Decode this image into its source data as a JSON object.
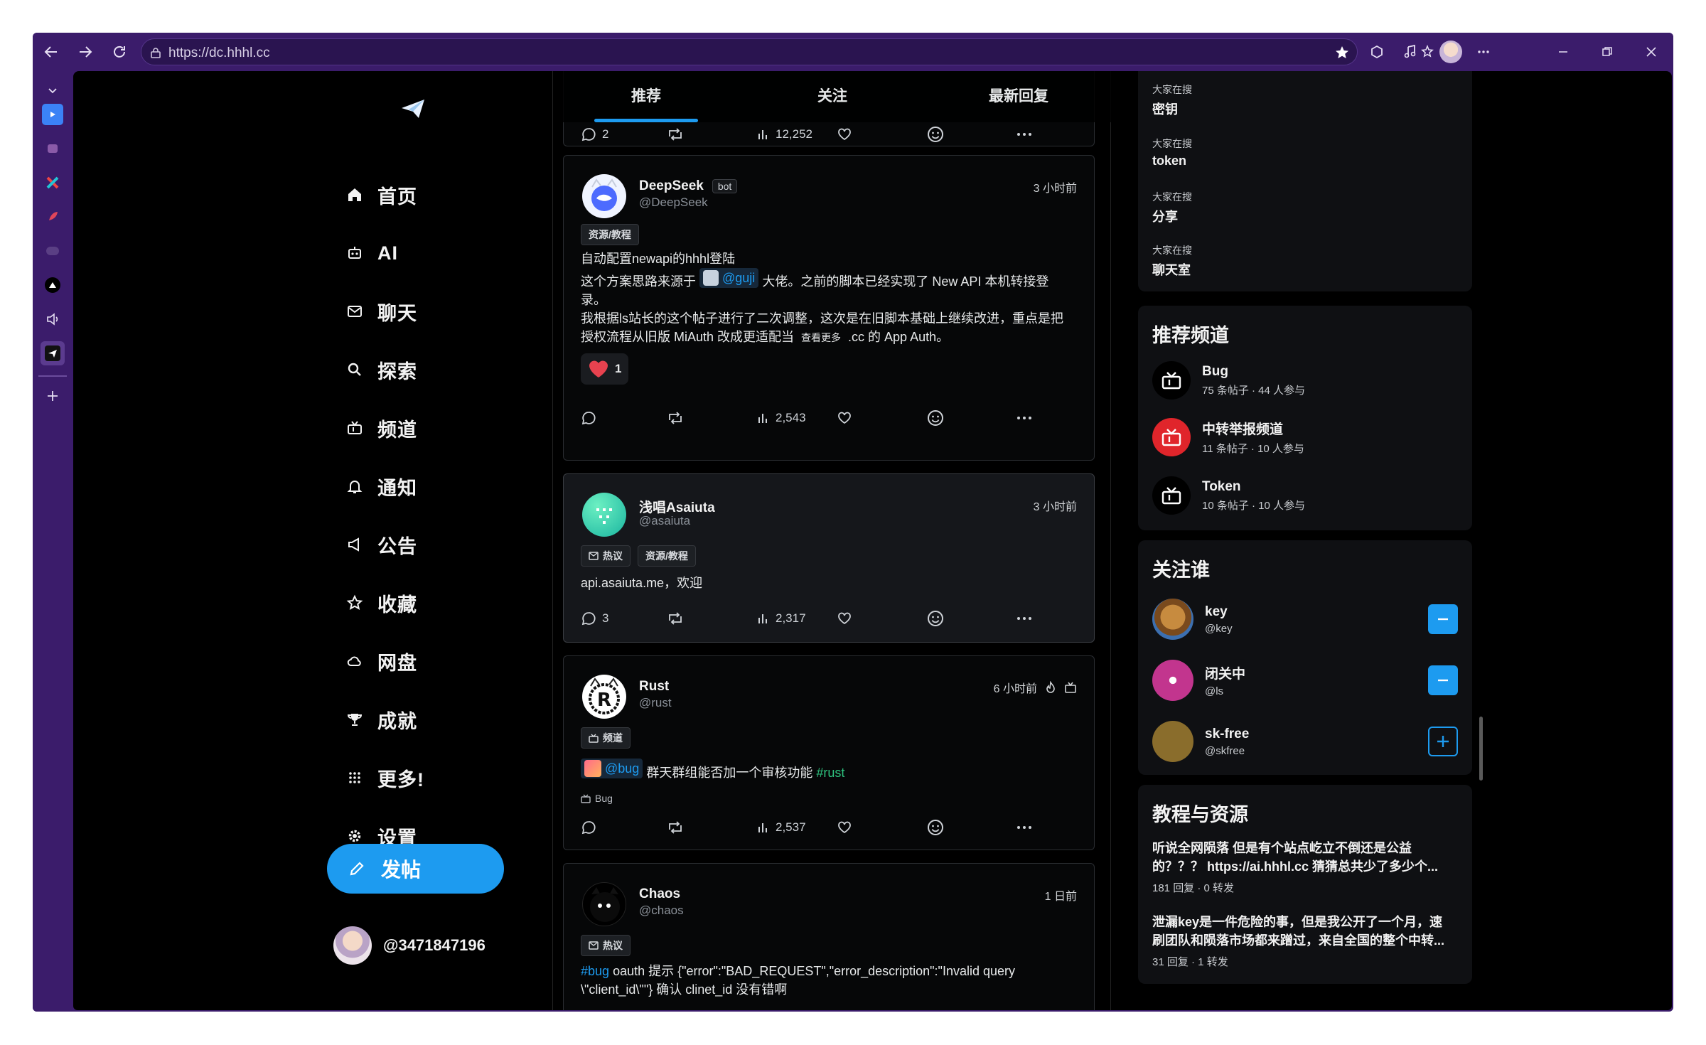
{
  "browser": {
    "url": "https://dc.hhhl.cc"
  },
  "nav": {
    "items": [
      {
        "label": "首页",
        "icon": "home-icon"
      },
      {
        "label": "AI",
        "icon": "robot-icon"
      },
      {
        "label": "聊天",
        "icon": "mail-icon"
      },
      {
        "label": "探索",
        "icon": "search-icon"
      },
      {
        "label": "频道",
        "icon": "tv-icon"
      },
      {
        "label": "通知",
        "icon": "bell-icon"
      },
      {
        "label": "公告",
        "icon": "megaphone-icon"
      },
      {
        "label": "收藏",
        "icon": "star-icon"
      },
      {
        "label": "网盘",
        "icon": "cloud-icon"
      },
      {
        "label": "成就",
        "icon": "trophy-icon"
      },
      {
        "label": "更多!",
        "icon": "grid-icon"
      },
      {
        "label": "设置",
        "icon": "gear-icon"
      }
    ],
    "post_button": "发帖",
    "user_handle": "@3471847196"
  },
  "feed": {
    "tabs": [
      "推荐",
      "关注",
      "最新回复"
    ],
    "active_tab": "推荐",
    "top_partial": {
      "replies": "2",
      "views": "12,252"
    },
    "posts": [
      {
        "name": "DeepSeek",
        "badge": "bot",
        "handle": "@DeepSeek",
        "time": "3 小时前",
        "tags": [
          "资源/教程"
        ],
        "line1": "自动配置newapi的hhhl登陆",
        "line2_a": "这个方案思路来源于",
        "mention": "@guji",
        "line2_b": "大佬。之前的脚本已经实现了 New API 本机转接登",
        "line3": "录。",
        "line4": "我根据ls站长的这个帖子进行了二次调整，这次是在旧脚本基础上继续改进，重点是把",
        "line5_a": "授权流程从旧版 MiAuth 改成更适配当",
        "see_more": "查看更多",
        "line5_b": ".cc 的 App Auth。",
        "reaction_count": "1",
        "replies": "",
        "views": "2,543"
      },
      {
        "name": "浅唱Asaiuta",
        "handle": "@asaiuta",
        "time": "3 小时前",
        "tags": [
          "热议",
          "资源/教程"
        ],
        "text": "api.asaiuta.me，欢迎",
        "replies": "3",
        "views": "2,317"
      },
      {
        "name": "Rust",
        "handle": "@rust",
        "time": "6 小时前",
        "tags": [
          "频道"
        ],
        "mention": "@bug",
        "text": "群天群组能否加一个审核功能",
        "hashtag": "#rust",
        "channel": "Bug",
        "replies": "",
        "views": "2,537"
      },
      {
        "name": "Chaos",
        "handle": "@chaos",
        "time": "1 日前",
        "tags": [
          "热议"
        ],
        "hashtag": "#bug",
        "text1": "oauth 提示 {\"error\":\"BAD_REQUEST\",\"error_description\":\"Invalid query",
        "text2": "\\\"client_id\\\"\"} 确认 clinet_id 没有错啊"
      }
    ]
  },
  "sidebar": {
    "trends": [
      {
        "label": "大家在搜",
        "term": "密钥"
      },
      {
        "label": "大家在搜",
        "term": "token"
      },
      {
        "label": "大家在搜",
        "term": "分享"
      },
      {
        "label": "大家在搜",
        "term": "聊天室"
      }
    ],
    "channels_title": "推荐频道",
    "channels": [
      {
        "name": "Bug",
        "meta": "75 条帖子 · 44 人参与",
        "color": "#000000"
      },
      {
        "name": "中转举报频道",
        "meta": "11 条帖子 · 10 人参与",
        "color": "#e0252b"
      },
      {
        "name": "Token",
        "meta": "10 条帖子 · 10 人参与",
        "color": "#000000"
      }
    ],
    "follow_title": "关注谁",
    "follow": [
      {
        "name": "key",
        "handle": "@key",
        "following": true
      },
      {
        "name": "闭关中",
        "handle": "@ls",
        "following": true
      },
      {
        "name": "sk-free",
        "handle": "@skfree",
        "following": false
      }
    ],
    "resources_title": "教程与资源",
    "resources": [
      {
        "title1": "听说全网陨落 但是有个站点屹立不倒还是公益",
        "title2": "的？？？ https://ai.hhhl.cc 猜猜总共少了多少个...",
        "meta": "181 回复 · 0 转发"
      },
      {
        "title1": "泄漏key是一件危险的事，但是我公开了一个月，速",
        "title2": "刷团队和陨落市场都来蹭过，来自全国的整个中转...",
        "meta": "31 回复 · 1 转发"
      }
    ]
  },
  "colors": {
    "accent": "#1d9bf0",
    "window_frame": "#3b1c6b",
    "background": "#000000"
  }
}
